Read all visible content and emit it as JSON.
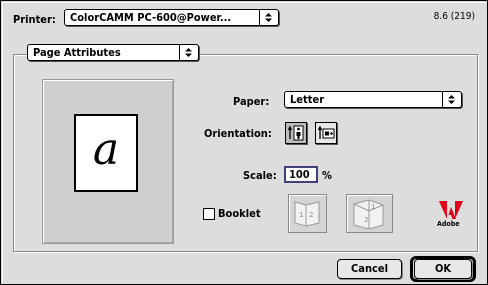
{
  "printer": {
    "label": "Printer:",
    "value": "ColorCAMM PC-600@Power..."
  },
  "version": "8.6 (219)",
  "panel_select": {
    "value": "Page Attributes"
  },
  "paper": {
    "label": "Paper:",
    "value": "Letter"
  },
  "orientation": {
    "label": "Orientation:",
    "options": [
      "portrait",
      "landscape"
    ],
    "selected": "portrait"
  },
  "scale": {
    "label": "Scale:",
    "value": "100",
    "unit": "%"
  },
  "booklet": {
    "label": "Booklet",
    "checked": false,
    "page_numbers": [
      "1",
      "2"
    ]
  },
  "preview": {
    "glyph": "a"
  },
  "adobe": {
    "wordmark": "Adobe"
  },
  "buttons": {
    "cancel": "Cancel",
    "ok": "OK"
  },
  "icons": {
    "popup_arrow": "updown-arrows-icon",
    "portrait": "portrait-orientation-icon",
    "landscape": "landscape-orientation-icon",
    "booklet_left": "booklet-left-edge-icon",
    "booklet_right": "booklet-right-edge-icon",
    "logo": "adobe-logo"
  },
  "colors": {
    "dialog_bg": "#dddddd",
    "focus_ring": "#404080",
    "adobe_red": "#e0001a"
  }
}
